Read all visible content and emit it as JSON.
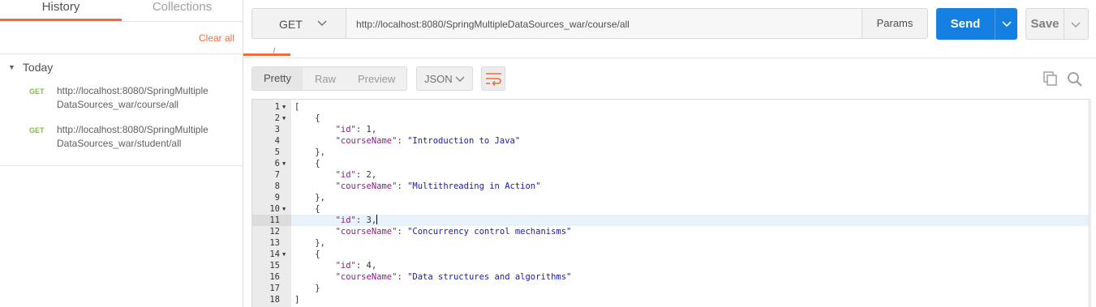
{
  "sidebar": {
    "tabs": {
      "history": "History",
      "collections": "Collections"
    },
    "clear_all": "Clear all",
    "group_label": "Today",
    "items": [
      {
        "method": "GET",
        "url": "http://localhost:8080/SpringMultipleDataSources_war/course/all"
      },
      {
        "method": "GET",
        "url": "http://localhost:8080/SpringMultipleDataSources_war/student/all"
      }
    ]
  },
  "request": {
    "method": "GET",
    "url": "http://localhost:8080/SpringMultipleDataSources_war/course/all",
    "params_label": "Params",
    "send_label": "Send",
    "save_label": "Save"
  },
  "response": {
    "view_tabs": {
      "pretty": "Pretty",
      "raw": "Raw",
      "preview": "Preview"
    },
    "format": "JSON",
    "active_line": 11,
    "lines": [
      {
        "n": "1",
        "fold": true,
        "tokens": [
          [
            "n",
            "["
          ]
        ]
      },
      {
        "n": "2",
        "fold": true,
        "tokens": [
          [
            "n",
            "    {"
          ]
        ]
      },
      {
        "n": "3",
        "fold": false,
        "tokens": [
          [
            "n",
            "        "
          ],
          [
            "k",
            "\"id\""
          ],
          [
            "n",
            ": 1,"
          ]
        ]
      },
      {
        "n": "4",
        "fold": false,
        "tokens": [
          [
            "n",
            "        "
          ],
          [
            "k",
            "\"courseName\""
          ],
          [
            "n",
            ": "
          ],
          [
            "s",
            "\"Introduction to Java\""
          ]
        ]
      },
      {
        "n": "5",
        "fold": false,
        "tokens": [
          [
            "n",
            "    },"
          ]
        ]
      },
      {
        "n": "6",
        "fold": true,
        "tokens": [
          [
            "n",
            "    {"
          ]
        ]
      },
      {
        "n": "7",
        "fold": false,
        "tokens": [
          [
            "n",
            "        "
          ],
          [
            "k",
            "\"id\""
          ],
          [
            "n",
            ": 2,"
          ]
        ]
      },
      {
        "n": "8",
        "fold": false,
        "tokens": [
          [
            "n",
            "        "
          ],
          [
            "k",
            "\"courseName\""
          ],
          [
            "n",
            ": "
          ],
          [
            "s",
            "\"Multithreading in Action\""
          ]
        ]
      },
      {
        "n": "9",
        "fold": false,
        "tokens": [
          [
            "n",
            "    },"
          ]
        ]
      },
      {
        "n": "10",
        "fold": true,
        "tokens": [
          [
            "n",
            "    {"
          ]
        ]
      },
      {
        "n": "11",
        "fold": false,
        "tokens": [
          [
            "n",
            "        "
          ],
          [
            "k",
            "\"id\""
          ],
          [
            "n",
            ": 3,"
          ]
        ]
      },
      {
        "n": "12",
        "fold": false,
        "tokens": [
          [
            "n",
            "        "
          ],
          [
            "k",
            "\"courseName\""
          ],
          [
            "n",
            ": "
          ],
          [
            "s",
            "\"Concurrency control mechanisms\""
          ]
        ]
      },
      {
        "n": "13",
        "fold": false,
        "tokens": [
          [
            "n",
            "    },"
          ]
        ]
      },
      {
        "n": "14",
        "fold": true,
        "tokens": [
          [
            "n",
            "    {"
          ]
        ]
      },
      {
        "n": "15",
        "fold": false,
        "tokens": [
          [
            "n",
            "        "
          ],
          [
            "k",
            "\"id\""
          ],
          [
            "n",
            ": 4,"
          ]
        ]
      },
      {
        "n": "16",
        "fold": false,
        "tokens": [
          [
            "n",
            "        "
          ],
          [
            "k",
            "\"courseName\""
          ],
          [
            "n",
            ": "
          ],
          [
            "s",
            "\"Data structures and algorithms\""
          ]
        ]
      },
      {
        "n": "17",
        "fold": false,
        "tokens": [
          [
            "n",
            "    }"
          ]
        ]
      },
      {
        "n": "18",
        "fold": false,
        "tokens": [
          [
            "n",
            "]"
          ]
        ]
      }
    ]
  },
  "colors": {
    "accent": "#f26b3a",
    "send": "#1680e2",
    "method_get": "#7cc142",
    "json_key": "#8b1a8b",
    "json_string": "#1a1aa6"
  },
  "icons": [
    "chevron-down-icon",
    "wrap-lines-icon",
    "copy-icon",
    "search-icon",
    "caret-down-icon"
  ]
}
